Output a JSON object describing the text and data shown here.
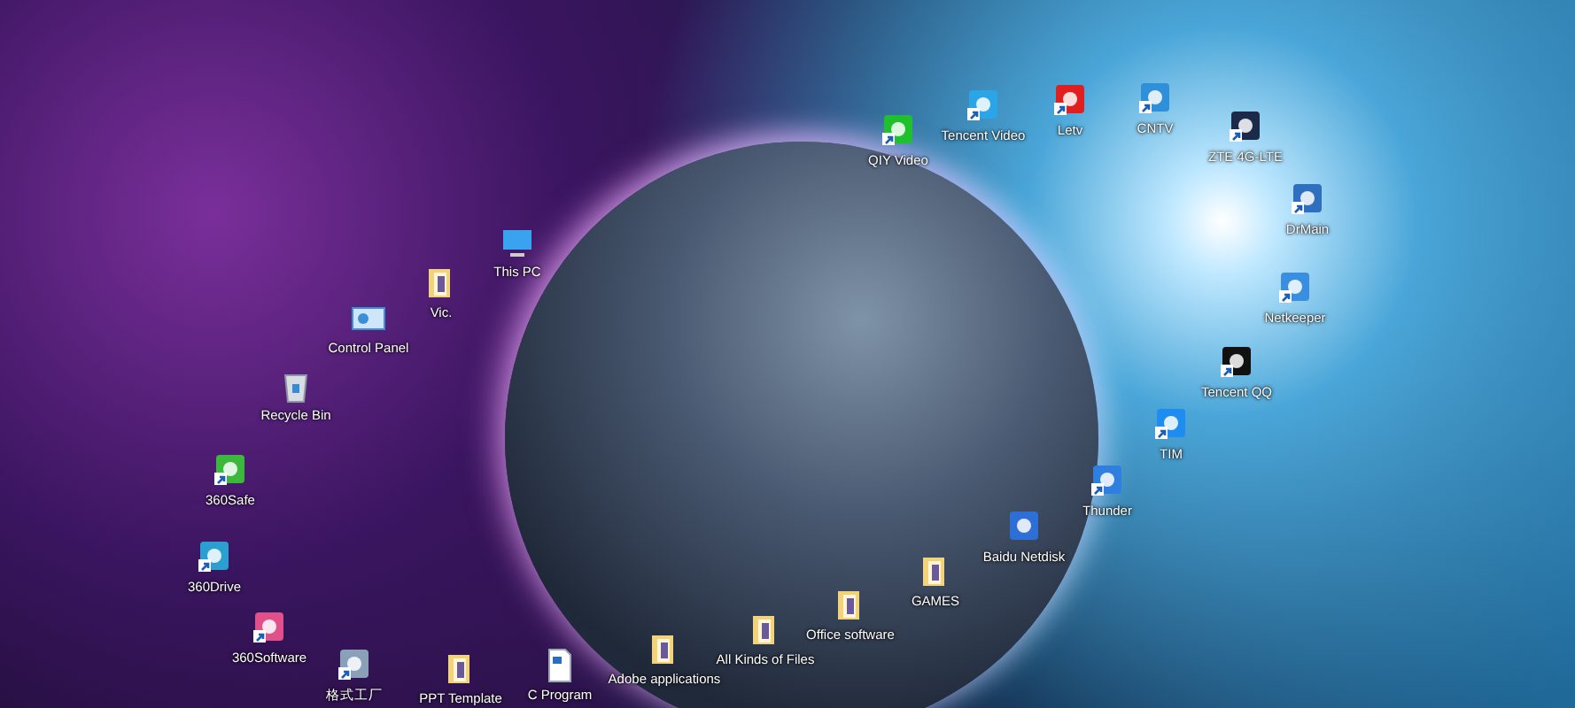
{
  "desktop": {
    "icons": [
      {
        "label": "360Drive",
        "kind": "app",
        "color": "#2a9fd0",
        "shortcut": true
      },
      {
        "label": "360Safe",
        "kind": "app",
        "color": "#3cb83c",
        "shortcut": true
      },
      {
        "label": "Recycle Bin",
        "kind": "bin",
        "shortcut": false
      },
      {
        "label": "360Software",
        "kind": "app",
        "color": "#e0508a",
        "shortcut": true
      },
      {
        "label": "格式工厂",
        "kind": "app",
        "color": "#8aa0b8",
        "shortcut": true
      },
      {
        "label": "Control Panel",
        "kind": "panel",
        "shortcut": false
      },
      {
        "label": "Vic.",
        "kind": "folder",
        "shortcut": false
      },
      {
        "label": "PPT Template",
        "kind": "folder",
        "shortcut": false
      },
      {
        "label": "This PC",
        "kind": "computer",
        "shortcut": false
      },
      {
        "label": "C Program",
        "kind": "document",
        "shortcut": false
      },
      {
        "label": "Adobe applications",
        "kind": "folder",
        "shortcut": false
      },
      {
        "label": "All Kinds of Files",
        "kind": "folder",
        "shortcut": false
      },
      {
        "label": "Office software",
        "kind": "folder",
        "shortcut": false
      },
      {
        "label": "QIY Video",
        "kind": "app",
        "color": "#1fbf2e",
        "shortcut": true
      },
      {
        "label": "GAMES",
        "kind": "folder",
        "shortcut": false
      },
      {
        "label": "Tencent Video",
        "kind": "app",
        "color": "#2aa6e8",
        "shortcut": true
      },
      {
        "label": "Baidu Netdisk",
        "kind": "app",
        "color": "#2d6fd6",
        "shortcut": false
      },
      {
        "label": "Letv",
        "kind": "app",
        "color": "#e02020",
        "shortcut": true
      },
      {
        "label": "Thunder",
        "kind": "app",
        "color": "#2f7fe0",
        "shortcut": true
      },
      {
        "label": "CNTV",
        "kind": "app",
        "color": "#2f8fd8",
        "shortcut": true
      },
      {
        "label": "TIM",
        "kind": "app",
        "color": "#1f8cf0",
        "shortcut": true
      },
      {
        "label": "Tencent QQ",
        "kind": "app",
        "color": "#111111",
        "shortcut": true
      },
      {
        "label": "ZTE 4G-LTE",
        "kind": "app",
        "color": "#1c2a4a",
        "shortcut": true
      },
      {
        "label": "Netkeeper",
        "kind": "app",
        "color": "#3a8ee0",
        "shortcut": true
      },
      {
        "label": "DrMain",
        "kind": "app",
        "color": "#2f6fc0",
        "shortcut": true
      }
    ]
  }
}
